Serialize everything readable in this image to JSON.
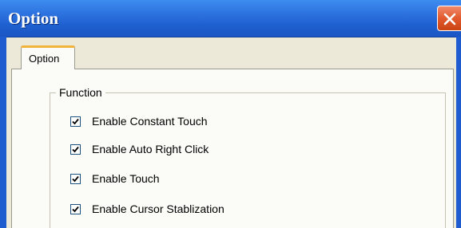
{
  "window": {
    "title": "Option"
  },
  "tabs": [
    {
      "label": "Option",
      "selected": true
    }
  ],
  "function_group": {
    "legend": "Function",
    "options": [
      {
        "label": "Enable Constant Touch",
        "checked": true
      },
      {
        "label": "Enable Auto Right Click",
        "checked": true
      },
      {
        "label": "Enable Touch",
        "checked": true
      },
      {
        "label": "Enable Cursor Stablization",
        "checked": true
      }
    ]
  },
  "icons": {
    "close": "close-icon",
    "check": "checkmark-icon"
  },
  "colors": {
    "title_bar": "#2e74e0",
    "close_button": "#e2592d",
    "dialog_background": "#ece9d8",
    "panel_background": "#fbfbf8",
    "tab_highlight": "#f0b43c"
  }
}
